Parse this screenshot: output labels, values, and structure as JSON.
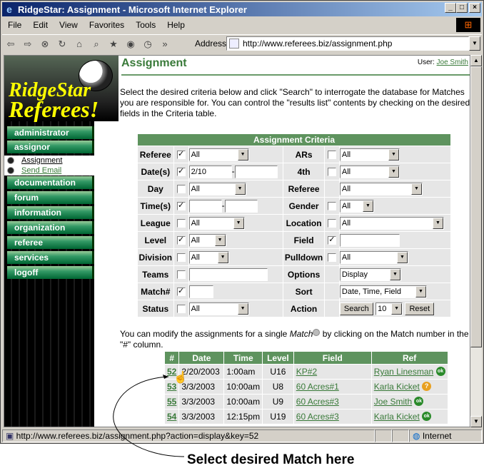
{
  "window": {
    "title": "RidgeStar: Assignment - Microsoft Internet Explorer"
  },
  "menu": [
    "File",
    "Edit",
    "View",
    "Favorites",
    "Tools",
    "Help"
  ],
  "address": {
    "label": "Address",
    "url": "http://www.referees.biz/assignment.php"
  },
  "status": {
    "url": "http://www.referees.biz/assignment.php?action=display&key=52",
    "zone": "Internet"
  },
  "logo": {
    "line1": "RidgeStar",
    "line2": "Referees!"
  },
  "nav": {
    "items": [
      "administrator",
      "assignor",
      "documentation",
      "forum",
      "information",
      "organization",
      "referee",
      "services",
      "logoff"
    ],
    "sub": [
      "Assignment",
      "Send Email"
    ]
  },
  "page": {
    "title": "Assignment",
    "user_label": "User:",
    "user_name": "Joe Smith",
    "intro": "Select the desired criteria below and click \"Search\" to interrogate the database for Matches you are responsible for. You can control the \"results list\" contents by checking on the desired fields in the Criteria table.",
    "mod_pre": "You can modify the assignments for a single ",
    "mod_em": "Match",
    "mod_post": " by clicking on the Match number in the \"#\" column."
  },
  "criteria": {
    "header": "Assignment Criteria",
    "left": [
      {
        "label": "Referee",
        "checked": true,
        "value": "All"
      },
      {
        "label": "Date(s)",
        "checked": true,
        "from": "2/10",
        "to": ""
      },
      {
        "label": "Day",
        "checked": false,
        "value": "All"
      },
      {
        "label": "Time(s)",
        "checked": true,
        "from": "",
        "to": ""
      },
      {
        "label": "League",
        "checked": false,
        "value": "All"
      },
      {
        "label": "Level",
        "checked": true,
        "value": "All"
      },
      {
        "label": "Division",
        "checked": false,
        "value": "All"
      },
      {
        "label": "Teams",
        "checked": false,
        "value": ""
      },
      {
        "label": "Match#",
        "checked": true,
        "value": ""
      },
      {
        "label": "Status",
        "checked": false,
        "value": "All"
      }
    ],
    "right": [
      {
        "label": "ARs",
        "checked": false,
        "value": "All"
      },
      {
        "label": "4th",
        "checked": false,
        "value": "All"
      },
      {
        "label": "Referee",
        "value": "All"
      },
      {
        "label": "Gender",
        "checked": false,
        "value": "All"
      },
      {
        "label": "Location",
        "checked": false,
        "value": "All"
      },
      {
        "label": "Field",
        "checked": true,
        "value": ""
      },
      {
        "label": "Pulldown",
        "checked": false,
        "value": "All"
      },
      {
        "label": "Options",
        "value": "Display"
      },
      {
        "label": "Sort",
        "value": "Date, Time, Field"
      },
      {
        "label": "Action",
        "search": "Search",
        "count": "10",
        "reset": "Reset"
      }
    ]
  },
  "matches": {
    "headers": [
      "#",
      "Date",
      "Time",
      "Level",
      "Field",
      "Ref"
    ],
    "rows": [
      {
        "num": "52",
        "date": "2/20/2003",
        "time": "1:00am",
        "level": "U16",
        "field": "KP#2",
        "ref": "Ryan Linesman",
        "status": "ok"
      },
      {
        "num": "53",
        "date": "3/3/2003",
        "time": "10:00am",
        "level": "U8",
        "field": "60 Acres#1",
        "ref": "Karla Kicket",
        "status": "q"
      },
      {
        "num": "55",
        "date": "3/3/2003",
        "time": "10:00am",
        "level": "U9",
        "field": "60 Acres#3",
        "ref": "Joe Smith",
        "status": "ok"
      },
      {
        "num": "54",
        "date": "3/3/2003",
        "time": "12:15pm",
        "level": "U19",
        "field": "60 Acres#3",
        "ref": "Karla Kicket",
        "status": "ok"
      }
    ]
  },
  "callout": "Select desired Match here"
}
